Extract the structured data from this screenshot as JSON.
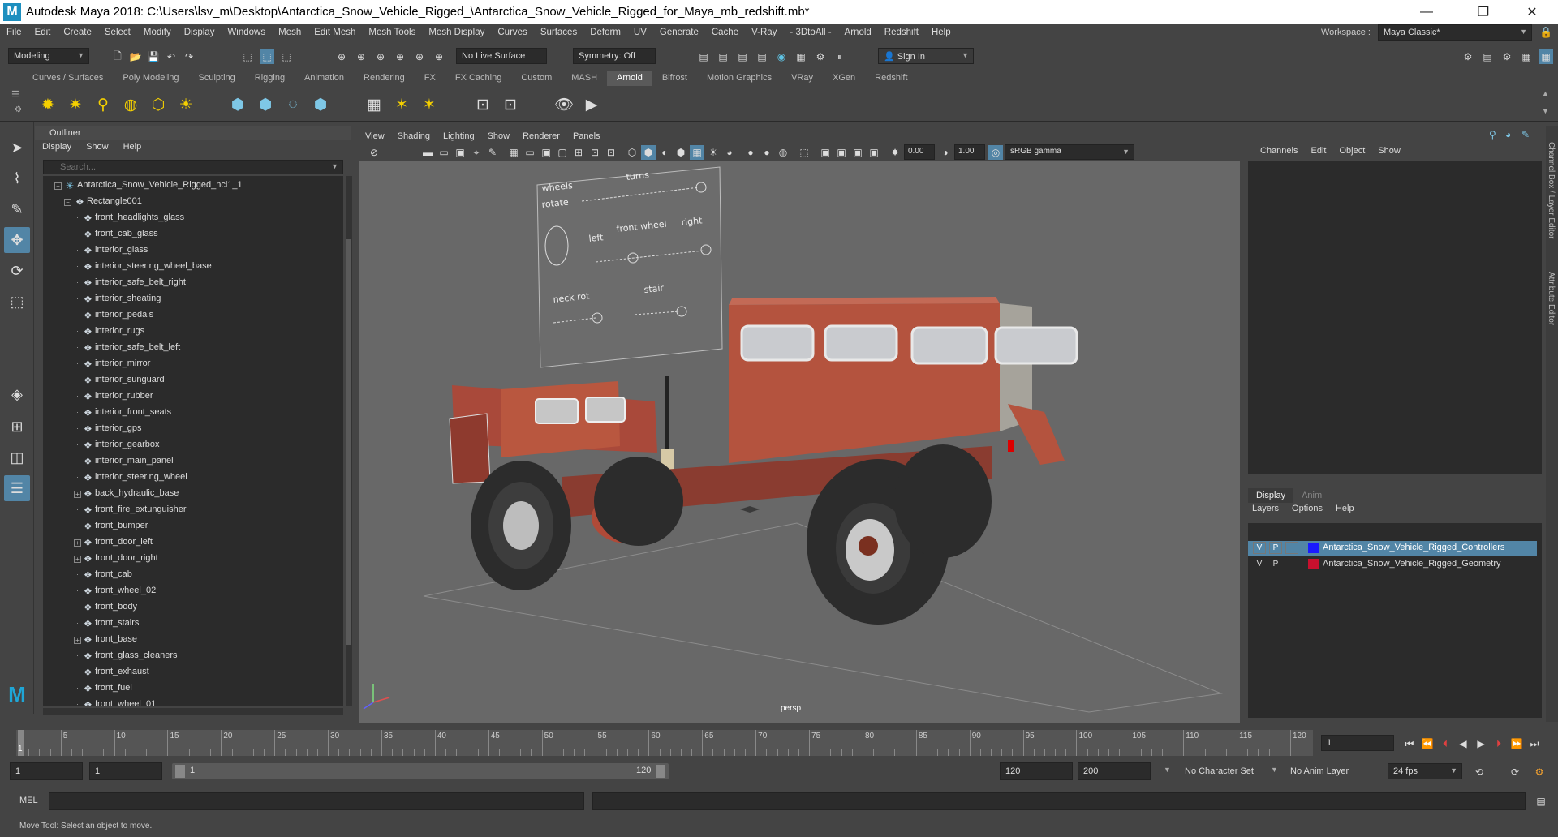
{
  "window": {
    "title": "Autodesk Maya 2018: C:\\Users\\lsv_m\\Desktop\\Antarctica_Snow_Vehicle_Rigged_\\Antarctica_Snow_Vehicle_Rigged_for_Maya_mb_redshift.mb*",
    "logo": "M",
    "minimize": "—",
    "restore": "❐",
    "close": "✕"
  },
  "menubar": {
    "items": [
      "File",
      "Edit",
      "Create",
      "Select",
      "Modify",
      "Display",
      "Windows",
      "Mesh",
      "Edit Mesh",
      "Mesh Tools",
      "Mesh Display",
      "Curves",
      "Surfaces",
      "Deform",
      "UV",
      "Generate",
      "Cache",
      "V-Ray",
      "- 3DtoAll -",
      "Arnold",
      "Redshift",
      "Help"
    ],
    "workspace_label": "Workspace :",
    "workspace_value": "Maya Classic*"
  },
  "statusline": {
    "mode": "Modeling",
    "live_surface": "No Live Surface",
    "symmetry": "Symmetry: Off",
    "sign_in": "Sign In"
  },
  "shelf": {
    "tabs": [
      "Curves / Surfaces",
      "Poly Modeling",
      "Sculpting",
      "Rigging",
      "Animation",
      "Rendering",
      "FX",
      "FX Caching",
      "Custom",
      "MASH",
      "Arnold",
      "Bifrost",
      "Motion Graphics",
      "VRay",
      "XGen",
      "Redshift"
    ],
    "active": "Arnold"
  },
  "outliner": {
    "title": "Outliner",
    "menu": [
      "Display",
      "Show",
      "Help"
    ],
    "search_placeholder": "Search...",
    "root": "Antarctica_Snow_Vehicle_Rigged_ncl1_1",
    "group": "Rectangle001",
    "items": [
      {
        "label": "front_headlights_glass",
        "expand": false
      },
      {
        "label": "front_cab_glass",
        "expand": false
      },
      {
        "label": "interior_glass",
        "expand": false
      },
      {
        "label": "interior_steering_wheel_base",
        "expand": false
      },
      {
        "label": "interior_safe_belt_right",
        "expand": false
      },
      {
        "label": "interior_sheating",
        "expand": false
      },
      {
        "label": "interior_pedals",
        "expand": false
      },
      {
        "label": "interior_rugs",
        "expand": false
      },
      {
        "label": "interior_safe_belt_left",
        "expand": false
      },
      {
        "label": "interior_mirror",
        "expand": false
      },
      {
        "label": "interior_sunguard",
        "expand": false
      },
      {
        "label": "interior_rubber",
        "expand": false
      },
      {
        "label": "interior_front_seats",
        "expand": false
      },
      {
        "label": "interior_gps",
        "expand": false
      },
      {
        "label": "interior_gearbox",
        "expand": false
      },
      {
        "label": "interior_main_panel",
        "expand": false
      },
      {
        "label": "interior_steering_wheel",
        "expand": false
      },
      {
        "label": "back_hydraulic_base",
        "expand": true
      },
      {
        "label": "front_fire_extunguisher",
        "expand": false
      },
      {
        "label": "front_bumper",
        "expand": false
      },
      {
        "label": "front_door_left",
        "expand": true
      },
      {
        "label": "front_door_right",
        "expand": true
      },
      {
        "label": "front_cab",
        "expand": false
      },
      {
        "label": "front_wheel_02",
        "expand": false
      },
      {
        "label": "front_body",
        "expand": false
      },
      {
        "label": "front_stairs",
        "expand": false
      },
      {
        "label": "front_base",
        "expand": true
      },
      {
        "label": "front_glass_cleaners",
        "expand": false
      },
      {
        "label": "front_exhaust",
        "expand": false
      },
      {
        "label": "front_fuel",
        "expand": false
      },
      {
        "label": "front_wheel_01",
        "expand": false
      }
    ]
  },
  "viewport": {
    "menu": [
      "View",
      "Shading",
      "Lighting",
      "Show",
      "Renderer",
      "Panels"
    ],
    "value_a": "0.00",
    "value_b": "1.00",
    "color_space": "sRGB gamma",
    "camera": "persp",
    "board_labels": [
      "wheels",
      "turns",
      "rotate",
      "left",
      "front wheel",
      "right",
      "neck rot",
      "stair"
    ],
    "colors": {
      "body": "#b4533e",
      "tire": "#2c2c2c",
      "bg": "#686868"
    }
  },
  "channelbox": {
    "menu": [
      "Channels",
      "Edit",
      "Object",
      "Show"
    ]
  },
  "layers": {
    "tabs": [
      "Display",
      "Anim"
    ],
    "menu": [
      "Layers",
      "Options",
      "Help"
    ],
    "rows": [
      {
        "v": "V",
        "p": "P",
        "color": "#1a1aff",
        "name": "Antarctica_Snow_Vehicle_Rigged_Controllers",
        "selected": true
      },
      {
        "v": "V",
        "p": "P",
        "color": "#c8102e",
        "name": "Antarctica_Snow_Vehicle_Rigged_Geometry",
        "selected": false
      }
    ]
  },
  "sidetabs": [
    "Channel Box / Layer Editor",
    "Attribute Editor"
  ],
  "timeline": {
    "ticks": [
      5,
      10,
      15,
      20,
      25,
      30,
      35,
      40,
      45,
      50,
      55,
      60,
      65,
      70,
      75,
      80,
      85,
      90,
      95,
      100,
      105,
      110,
      115,
      120
    ],
    "current_frame": "1",
    "current_field": "1"
  },
  "range": {
    "start": "1",
    "anim_start": "1",
    "slider_start": "1",
    "slider_end": "120",
    "end": "120",
    "anim_end": "200",
    "character_set": "No Character Set",
    "anim_layer": "No Anim Layer",
    "fps": "24 fps"
  },
  "cmdline": {
    "label": "MEL"
  },
  "helpline": {
    "text": "Move Tool: Select an object to move."
  }
}
